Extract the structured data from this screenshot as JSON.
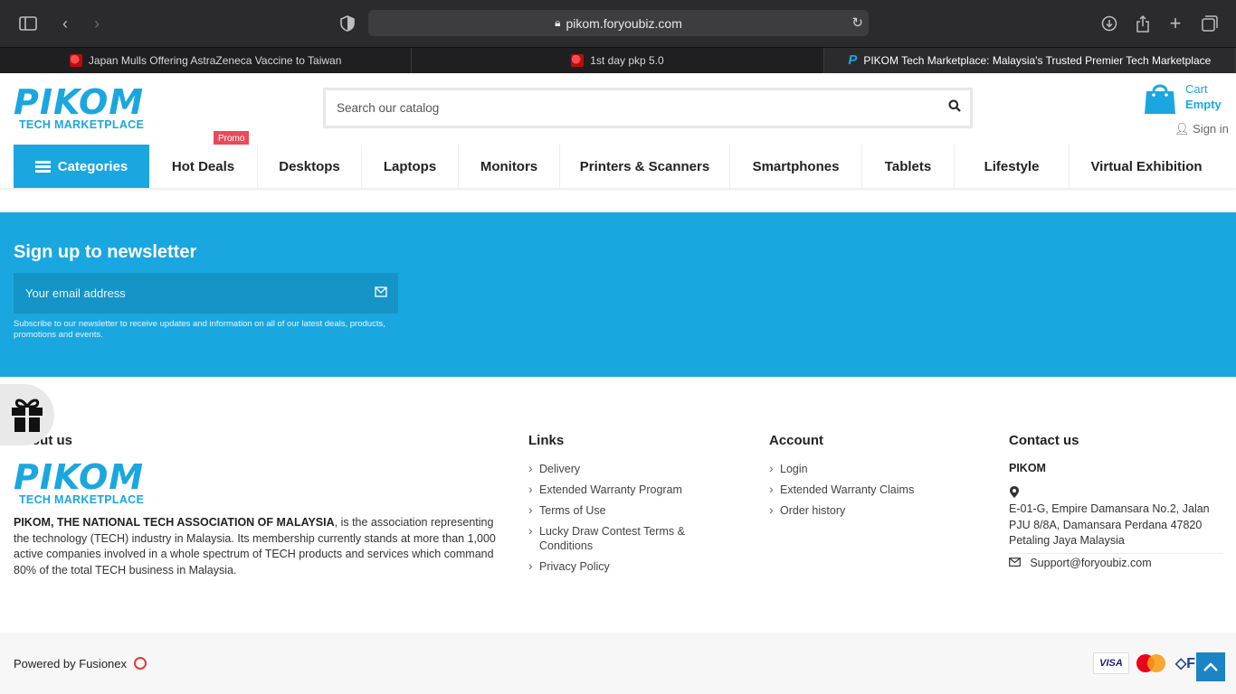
{
  "browser": {
    "url": "pikom.foryoubiz.com",
    "tabs": [
      {
        "title": "Japan Mulls Offering AstraZeneca Vaccine to Taiwan"
      },
      {
        "title": "1st day pkp 5.0"
      },
      {
        "title": "PIKOM Tech Marketplace: Malaysia's Trusted Premier Tech Marketplace"
      }
    ]
  },
  "header": {
    "logo_word": "PIKOM",
    "logo_sub": "TECH MARKETPLACE",
    "search_placeholder": "Search our catalog",
    "cart_label": "Cart",
    "cart_status": "Empty",
    "signin": "Sign in",
    "promo_badge": "Promo",
    "accent": "#1aa7e0"
  },
  "menu": {
    "categories": "Categories",
    "items": [
      "Hot Deals",
      "Desktops",
      "Laptops",
      "Monitors",
      "Printers & Scanners",
      "Smartphones",
      "Tablets",
      "Lifestyle",
      "Virtual Exhibition"
    ]
  },
  "newsletter": {
    "title": "Sign up to newsletter",
    "placeholder": "Your email address",
    "note": "Subscribe to our newsletter to receive updates and information on all of our latest deals, products, promotions and events."
  },
  "footer": {
    "about": {
      "title": "About us",
      "lead": "PIKOM, THE NATIONAL TECH ASSOCIATION OF MALAYSIA",
      "text": ", is the association representing the technology (TECH) industry in Malaysia. Its membership currently stands at more than 1,000 active companies involved in a whole spectrum of TECH products and services which command 80% of the total TECH business in Malaysia."
    },
    "links": {
      "title": "Links",
      "items": [
        "Delivery",
        "Extended Warranty Program",
        "Terms of Use",
        "Lucky Draw Contest Terms & Conditions",
        "Privacy Policy"
      ]
    },
    "account": {
      "title": "Account",
      "items": [
        "Login",
        "Extended Warranty Claims",
        "Order history"
      ]
    },
    "contact": {
      "title": "Contact us",
      "name": "PIKOM",
      "address": "E-01-G, Empire Damansara No.2, Jalan PJU 8/8A, Damansara Perdana 47820 Petaling Jaya Malaysia",
      "email": "Support@foryoubiz.com"
    }
  },
  "bottom": {
    "powered": "Powered by Fusionex",
    "payments": [
      "VISA",
      "MasterCard",
      "FPX"
    ]
  }
}
